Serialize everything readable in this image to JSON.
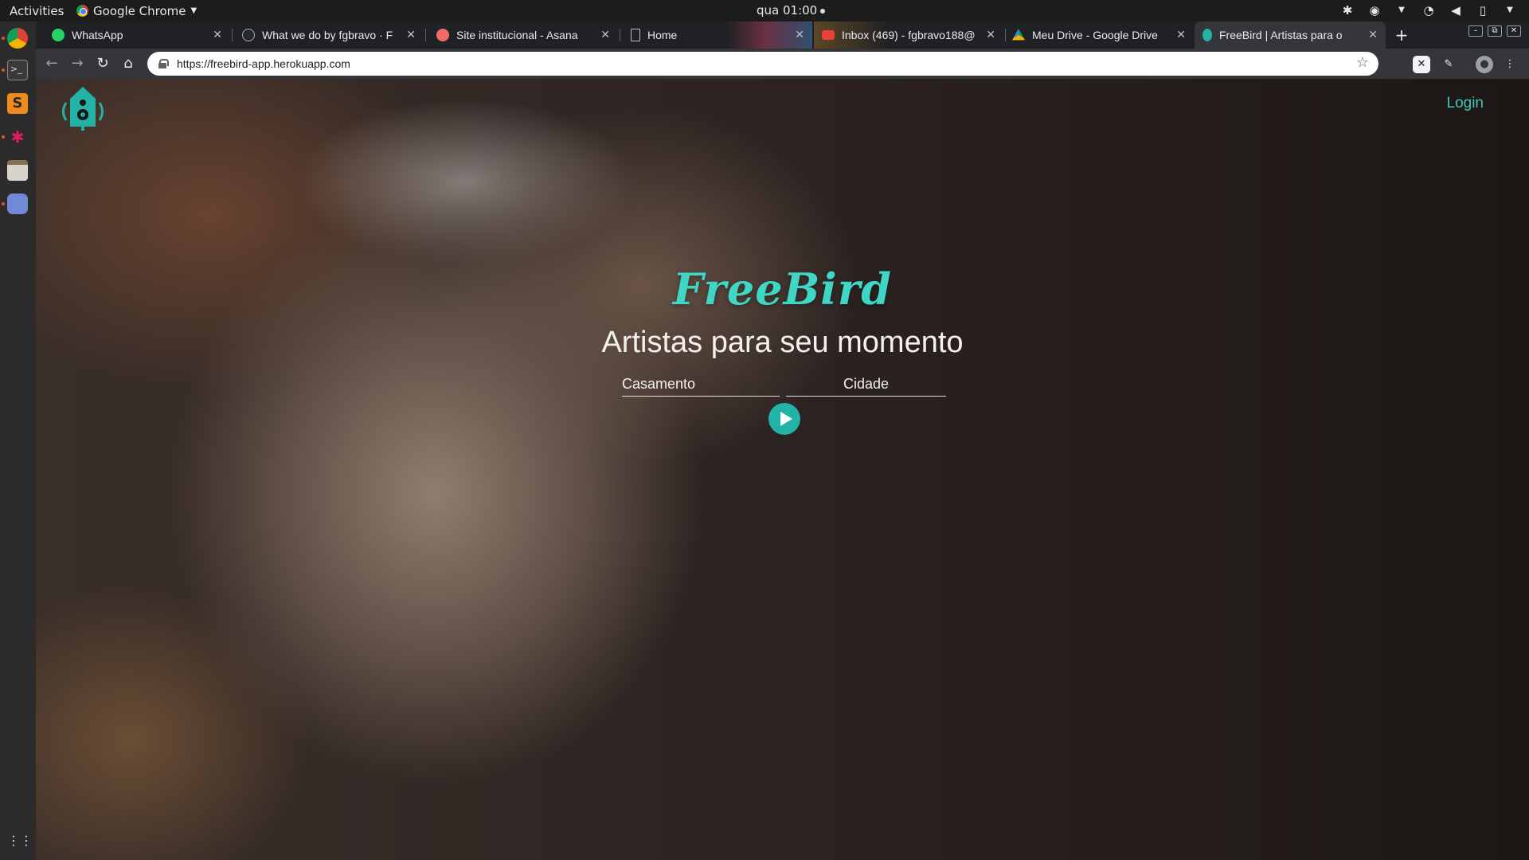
{
  "os": {
    "activities_label": "Activities",
    "app_name": "Google Chrome",
    "clock": "qua 01:00"
  },
  "browser": {
    "tabs": [
      {
        "title": "WhatsApp",
        "active": false
      },
      {
        "title": "What we do by fgbravo · F",
        "active": false
      },
      {
        "title": "Site institucional - Asana",
        "active": false
      },
      {
        "title": "Home",
        "active": false
      },
      {
        "title": "Inbox (469) - fgbravo188@",
        "active": false
      },
      {
        "title": "Meu Drive - Google Drive",
        "active": false
      },
      {
        "title": "FreeBird | Artistas para o",
        "active": true
      }
    ],
    "url": "https://freebird-app.herokuapp.com"
  },
  "site": {
    "login_label": "Login",
    "brand": "FreeBird",
    "tagline": "Artistas para seu momento",
    "event_value": "Casamento",
    "city_placeholder": "Cidade"
  },
  "colors": {
    "accent": "#3cc7bd",
    "button": "#22b3a6"
  }
}
